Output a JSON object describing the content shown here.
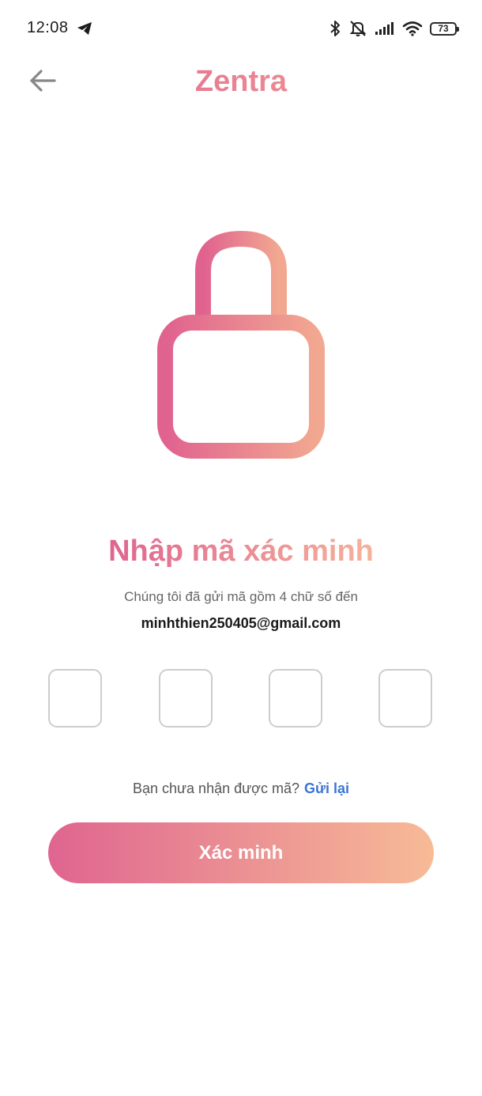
{
  "status_bar": {
    "time": "12:08",
    "battery": "73",
    "icons": [
      "telegram-icon",
      "bluetooth-icon",
      "mute-icon",
      "signal-icon",
      "wifi-icon",
      "battery-icon"
    ]
  },
  "header": {
    "back_icon": "arrow-left-icon",
    "title": "Zentra"
  },
  "hero": {
    "icon": "lock-icon",
    "gradient": [
      "#e0628f",
      "#f2a890"
    ]
  },
  "verify": {
    "heading": "Nhập mã xác minh",
    "subtitle": "Chúng tôi đã gửi mã gồm 4 chữ số đến",
    "email": "minhthien250405@gmail.com",
    "code_boxes": [
      "",
      "",
      "",
      ""
    ],
    "resend_prompt": "Bạn chưa nhận được mã?",
    "resend_link": "Gửi lại",
    "button_label": "Xác minh"
  },
  "colors": {
    "accent_start": "#df6590",
    "accent_end": "#f7bb96",
    "link": "#3b74d6",
    "box_border": "#cdcdcd"
  }
}
